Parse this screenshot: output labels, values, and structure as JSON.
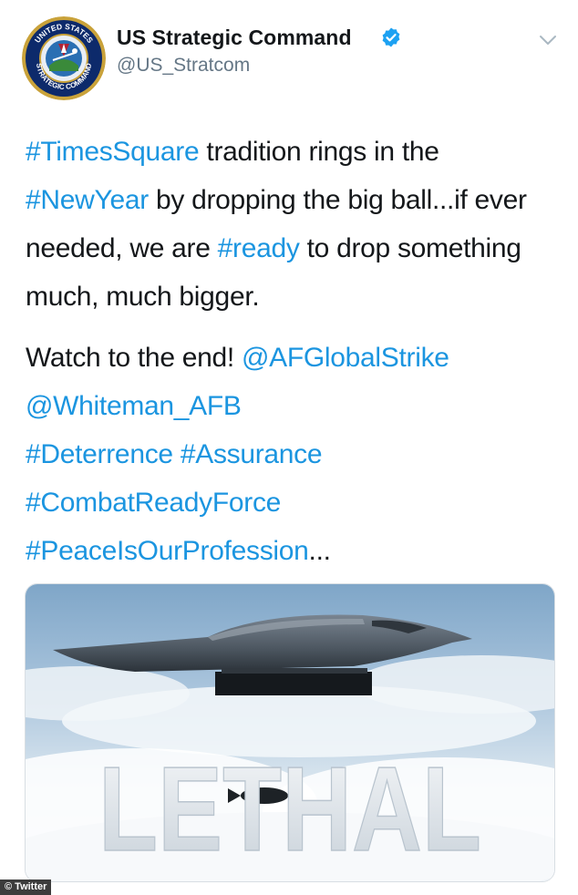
{
  "tweet": {
    "display_name": "US Strategic Command",
    "handle": "@US_Stratcom",
    "verified": true,
    "avatar_icon": "stratcom-seal-logo",
    "avatar_lettering": [
      "UNITED STATES",
      "STRATEGIC COMMAND"
    ],
    "menu_icon": "chevron-down-icon",
    "paragraph1": [
      {
        "text": "#TimesSquare",
        "link": true
      },
      {
        "text": " tradition rings in the ",
        "link": false
      },
      {
        "text": "#NewYear",
        "link": true
      },
      {
        "text": " by dropping the big ball...if ever needed, we are ",
        "link": false
      },
      {
        "text": "#ready",
        "link": true
      },
      {
        "text": " to drop something much, much bigger.",
        "link": false
      }
    ],
    "paragraph2_lines": [
      [
        {
          "text": "Watch to the end! ",
          "link": false
        },
        {
          "text": "@AFGlobalStrike",
          "link": true
        }
      ],
      [
        {
          "text": "@Whiteman_AFB",
          "link": true
        }
      ],
      [
        {
          "text": "#Deterrence",
          "link": true
        },
        {
          "text": " ",
          "link": false
        },
        {
          "text": "#Assurance",
          "link": true
        }
      ],
      [
        {
          "text": "#CombatReadyForce",
          "link": true
        }
      ],
      [
        {
          "text": "#PeaceIsOurProfession",
          "link": true
        },
        {
          "text": "...",
          "link": false
        }
      ]
    ],
    "media": {
      "overlay_text": "LETHAL",
      "subject": "stealth-bomber-image"
    }
  },
  "watermark": "© Twitter",
  "colors": {
    "link": "#1b95e0",
    "text": "#14171a",
    "muted": "#657786",
    "verified": "#1da1f2"
  }
}
